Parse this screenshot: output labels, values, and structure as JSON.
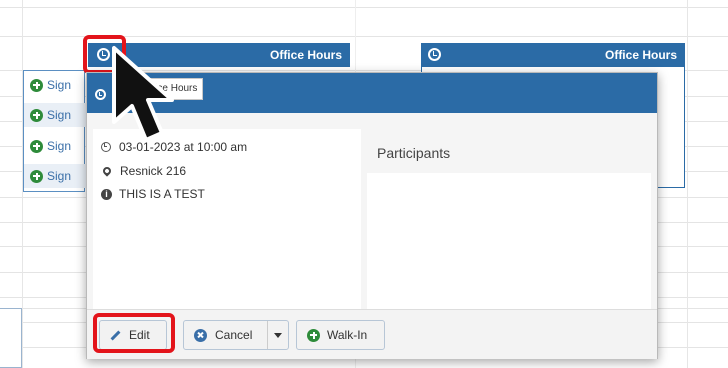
{
  "calendar": {
    "events": [
      {
        "title": "Office Hours"
      },
      {
        "title": "Office Hours"
      }
    ],
    "signup_items": [
      {
        "label": "Sign"
      },
      {
        "label": "Sign"
      },
      {
        "label": "Sign"
      },
      {
        "label": "Sign"
      }
    ]
  },
  "popup": {
    "tab_label": "Office Hours",
    "datetime": "03-01-2023 at 10:00 am",
    "location": "Resnick 216",
    "description": "THIS IS A TEST",
    "participants_title": "Participants",
    "buttons": {
      "edit": "Edit",
      "cancel": "Cancel",
      "walkin": "Walk-In"
    }
  },
  "colors": {
    "header_blue": "#2b6ba6",
    "highlight_red": "#e3141b",
    "plus_green": "#2e8b3a"
  }
}
